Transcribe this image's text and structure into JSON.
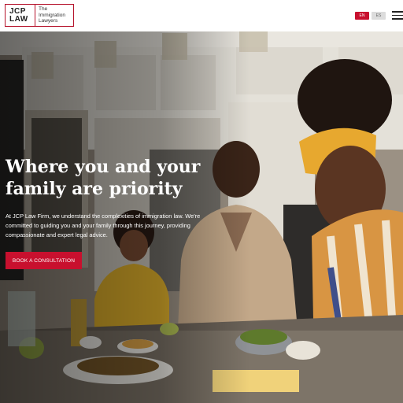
{
  "header": {
    "logo": {
      "mark_top": "JCP",
      "mark_bottom": "LAW",
      "line1": "The",
      "line2": "Immigration",
      "line3": "Lawyers"
    },
    "languages": [
      "EN",
      "ES"
    ],
    "active_language": "EN",
    "menu_icon": "hamburger-icon"
  },
  "hero": {
    "headline": "Where you and your family are priority",
    "description": "At JCP Law Firm, we understand the complexities of immigration law. We're committed to guiding you and your family through this journey, providing compassionate and expert legal advice.",
    "cta_label": "BOOK A CONSULTATION",
    "image_alt": "Family preparing food together around a kitchen counter"
  },
  "colors": {
    "brand": "#c8102e",
    "text_light": "#ffffff"
  }
}
